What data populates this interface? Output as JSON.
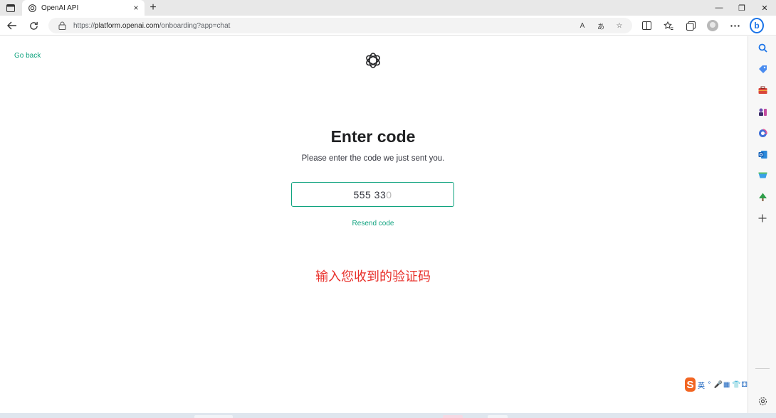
{
  "browser": {
    "tab_title": "OpenAI API",
    "new_tab_symbol": "+",
    "close_symbol": "×",
    "url_prefix": "https://",
    "url_host": "platform.openai.com",
    "url_path": "/onboarding?app=chat",
    "window_controls": [
      "—",
      "❐",
      "✕"
    ],
    "addr_icons": [
      "A",
      "あ",
      "☆"
    ],
    "bing_label": "b"
  },
  "page": {
    "go_back": "Go back",
    "heading": "Enter code",
    "subtitle": "Please enter the code we just sent you.",
    "code_value": "555 33",
    "code_placeholder_rest": "0",
    "resend": "Resend code",
    "annotation": "输入您收到的验证码"
  },
  "ime": {
    "logo": "S",
    "items": [
      "英",
      "°",
      "🎤",
      "▦",
      "👕",
      "⚃"
    ]
  },
  "colors": {
    "accent": "#10a37f",
    "annotation": "#e8302a"
  }
}
